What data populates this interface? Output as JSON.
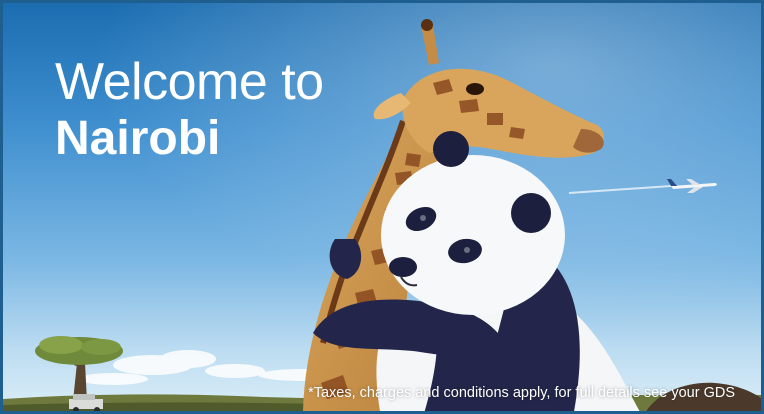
{
  "headline": {
    "line1": "Welcome to",
    "line2": "Nairobi"
  },
  "disclaimer": "*Taxes, charges and conditions apply, for full details see your GDS",
  "colors": {
    "sky_top": "#1b6db1",
    "sky_bottom": "#dbeef8",
    "border": "#1f5f8f",
    "text": "#ffffff"
  }
}
